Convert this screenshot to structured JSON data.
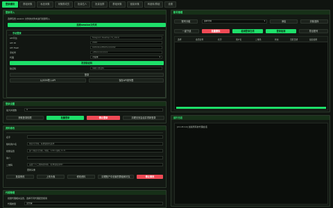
{
  "tabs": [
    "登录模块",
    "群组采集",
    "私信采集",
    "采集群成员",
    "批量拉人",
    "批量加群",
    "群组采集",
    "链接采集",
    "转链转/群链",
    "设置"
  ],
  "login": {
    "title": "登录导入",
    "desc": "选择包含 session 文件的文件夹进行批量导入",
    "import_btn": "选择session文件夹",
    "manual_title": "手动登录",
    "fields": [
      {
        "label": "API平台",
        "value": "Telegram Desktop (Tl_10x1)"
      },
      {
        "label": "API ID",
        "value": "2040"
      },
      {
        "label": "API Hash",
        "value": "b18441a1ff607e10dc62"
      },
      {
        "label": "手机号",
        "value": "+86xxxxxxxxxx"
      },
      {
        "label": "代理",
        "value": "不使用"
      }
    ],
    "send_code_btn": "发送验证码",
    "code_label": "验证码",
    "code_placeholder": "请输入验证码",
    "login_btn": "登录",
    "json_import_btn": "从JSON导入API",
    "save_api_btn": "保存API到列表"
  },
  "proxy": {
    "title": "登录设置",
    "threads_label": "最大并发数",
    "threads_value": "3",
    "btns": [
      "获取登录权限",
      "批量登录",
      "停止登录",
      "清理无效会话并重新登录"
    ]
  },
  "profile": {
    "title": "资料修改",
    "fields": [
      {
        "label": "名字",
        "placeholder": ""
      },
      {
        "label": "随机用户名",
        "placeholder": "用逗号分隔，系统会随机选择"
      },
      {
        "label": "批量设置",
        "placeholder": "多个用逗号分隔，例如：A,B,C,随机 (1-3)"
      },
      {
        "label": "简介",
        "placeholder": ""
      },
      {
        "label": "二维码",
        "placeholder": "设置个人二维码的风格（暂未在使用中）"
      }
    ],
    "avatar_label": "更换头像",
    "btns": [
      "批量修改",
      "上传头像",
      "修改资料",
      "清理账户中设置的群组和好友",
      "停止修改"
    ]
  },
  "proxy_mgmt": {
    "title": "代理管理",
    "desc": "批量代理相关设置，选择不同代理配置使用",
    "type_label": "代理类型",
    "type_value": "无代理"
  },
  "accounts": {
    "title": "账号管理",
    "group_label": "账号分组",
    "group_value": "选择分组",
    "add_btn": "添加",
    "clear_btn": "清除选择",
    "row2": [
      "一键下线",
      "批量删除",
      "检测登录在线",
      "登录检测",
      "导出账号"
    ],
    "columns": [
      "选择",
      "会话名称",
      "名字",
      "用户名",
      "二维码",
      "状态",
      "活跃日期",
      "最后使用"
    ]
  },
  "log": {
    "title": "运行日志",
    "lines": [
      "[21:45:14] 加载所有的代理会话"
    ]
  },
  "colors": {
    "accent": "#1ee06a",
    "danger": "#ef4a55",
    "bg": "#101410"
  }
}
